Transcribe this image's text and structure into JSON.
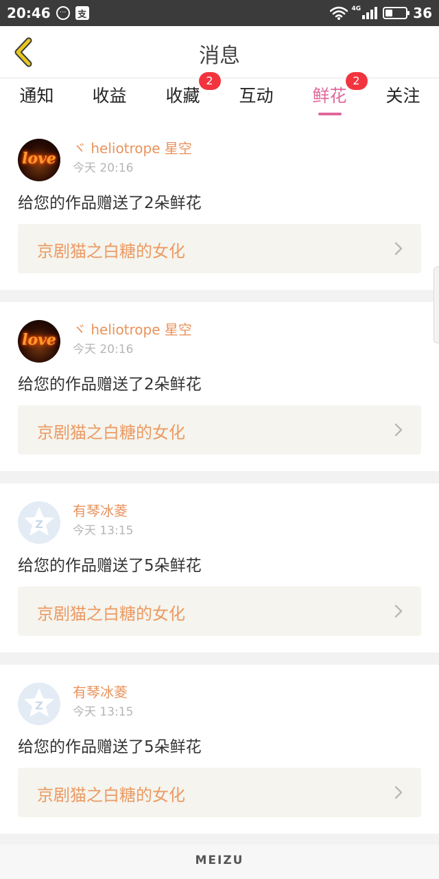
{
  "status_bar": {
    "time": "20:46",
    "chat_glyph": "···",
    "pay_glyph": "支",
    "network": "4G",
    "battery_percent": "36",
    "battery_level": 0.36,
    "icons": [
      "chat-bubble-icon",
      "alipay-icon",
      "wifi-icon",
      "signal-icon",
      "battery-icon"
    ]
  },
  "header": {
    "title": "消息",
    "back_icon": "chevron-left-icon",
    "back_color": "#e8c81e"
  },
  "tabs": [
    {
      "label": "通知",
      "badge": ""
    },
    {
      "label": "收益",
      "badge": ""
    },
    {
      "label": "收藏",
      "badge": "2"
    },
    {
      "label": "互动",
      "badge": ""
    },
    {
      "label": "鲜花",
      "badge": "2",
      "active": true
    },
    {
      "label": "关注",
      "badge": ""
    }
  ],
  "colors": {
    "accent": "#e0679a",
    "author": "#e8935c",
    "badge": "#f2343e",
    "work_title": "#eb9a62"
  },
  "messages": [
    {
      "avatar": "love-fire-avatar",
      "avatar_text": "love",
      "author": "ヾ heliotrope 星空",
      "time": "今天 20:16",
      "text": "给您的作品赠送了2朵鲜花",
      "work_title": "京剧猫之白糖的女化"
    },
    {
      "avatar": "love-fire-avatar",
      "avatar_text": "love",
      "author": "ヾ heliotrope 星空",
      "time": "今天 20:16",
      "text": "给您的作品赠送了2朵鲜花",
      "work_title": "京剧猫之白糖的女化"
    },
    {
      "avatar": "qq-star-avatar",
      "author": "有琴冰菱",
      "time": "今天 13:15",
      "text": "给您的作品赠送了5朵鲜花",
      "work_title": "京剧猫之白糖的女化"
    },
    {
      "avatar": "qq-star-avatar",
      "author": "有琴冰菱",
      "time": "今天 13:15",
      "text": "给您的作品赠送了5朵鲜花",
      "work_title": "京剧猫之白糖的女化"
    }
  ],
  "footer": {
    "brand": "MEIZU"
  }
}
